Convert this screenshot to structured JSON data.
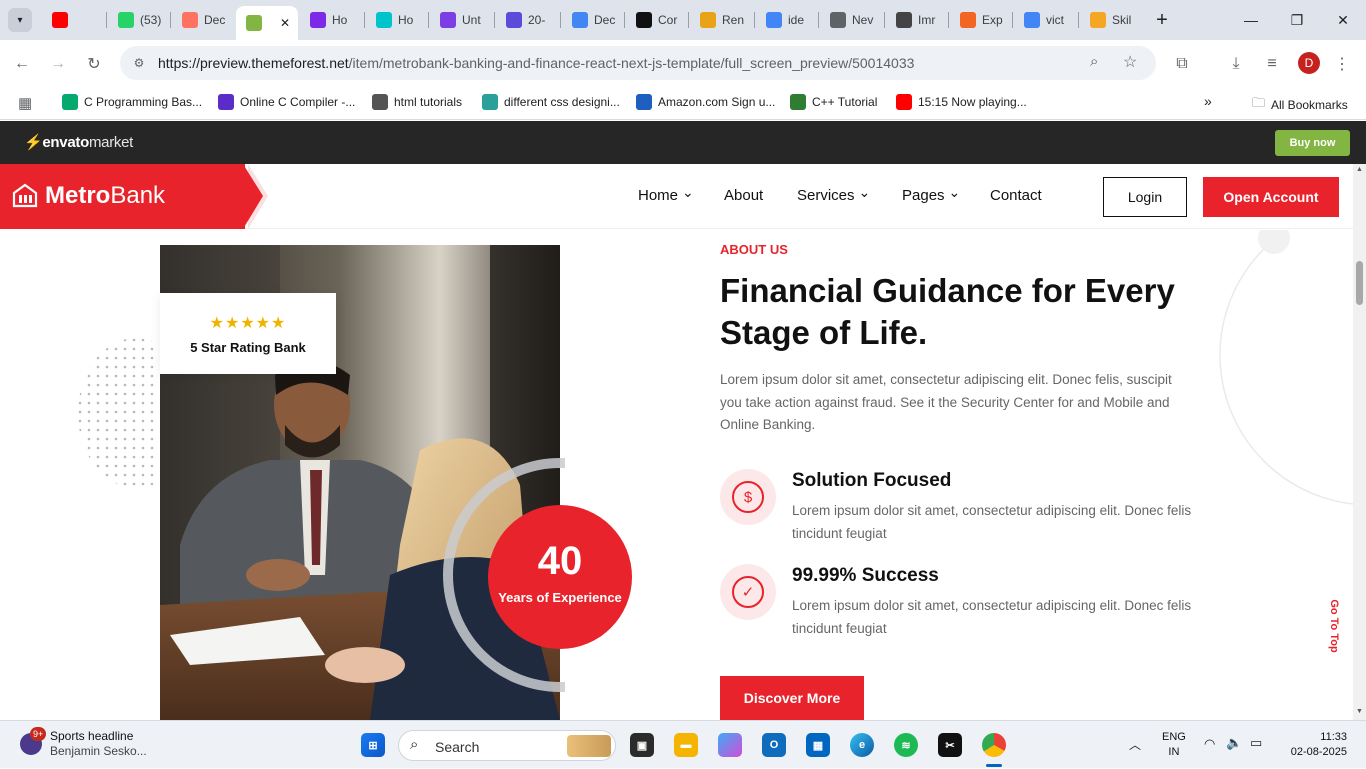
{
  "browser": {
    "tabs": [
      {
        "label": "",
        "fav": "youtube-icon",
        "color": "#ff0000"
      },
      {
        "label": "(53)",
        "fav": "whatsapp-icon",
        "color": "#25d366"
      },
      {
        "label": "Dec",
        "fav": "figma-icon",
        "color": "#ff7262"
      },
      {
        "label": "",
        "fav": "envato-icon",
        "color": "#82b541"
      },
      {
        "label": "Ho",
        "fav": "canva-icon",
        "color": "#7d2ae8"
      },
      {
        "label": "Ho",
        "fav": "canva-icon",
        "color": "#00c4cc"
      },
      {
        "label": "Unt",
        "fav": "app-icon",
        "color": "#7b3fe4"
      },
      {
        "label": "20-",
        "fav": "app-icon",
        "color": "#5b4bdb"
      },
      {
        "label": "Dec",
        "fav": "docs-icon",
        "color": "#4285f4"
      },
      {
        "label": "Cor",
        "fav": "nextjs-icon",
        "color": "#111111"
      },
      {
        "label": "Ren",
        "fav": "cap-icon",
        "color": "#e8a317"
      },
      {
        "label": "ide",
        "fav": "google-icon",
        "color": "#4285f4"
      },
      {
        "label": "Nev",
        "fav": "chrome-icon",
        "color": "#5f6368"
      },
      {
        "label": "Imr",
        "fav": "image-icon",
        "color": "#444444"
      },
      {
        "label": "Exp",
        "fav": "app-icon",
        "color": "#f26522"
      },
      {
        "label": "vict",
        "fav": "google-icon",
        "color": "#4285f4"
      },
      {
        "label": "Skil",
        "fav": "app-icon",
        "color": "#f5a623"
      }
    ],
    "url_host": "https://preview.themeforest.net",
    "url_rest": "/item/metrobank-banking-and-finance-react-next-js-template/full_screen_preview/50014033",
    "profile_initial": "D",
    "bookmarks": [
      {
        "label": "C Programming Bas...",
        "fav": "w3schools-icon",
        "color": "#04aa6d"
      },
      {
        "label": "Online C Compiler -...",
        "fav": "compiler-icon",
        "color": "#5a2dc8"
      },
      {
        "label": "html tutorials",
        "fav": "html-icon",
        "color": "#555555"
      },
      {
        "label": "different css designi...",
        "fav": "css-icon",
        "color": "#2aa198"
      },
      {
        "label": "Amazon.com Sign u...",
        "fav": "amazon-icon",
        "color": "#1e5fbf"
      },
      {
        "label": "C++ Tutorial",
        "fav": "w3resource-icon",
        "color": "#2e7d32"
      },
      {
        "label": "15:15 Now playing...",
        "fav": "youtube-icon",
        "color": "#ff0000"
      }
    ],
    "all_bookmarks": "All Bookmarks"
  },
  "envato": {
    "logo_bold": "envato",
    "logo_rest": "market",
    "buy_now": "Buy now"
  },
  "header": {
    "logo_bold": "Metro",
    "logo_rest": "Bank",
    "nav": [
      {
        "label": "Home",
        "dropdown": true
      },
      {
        "label": "About",
        "dropdown": false
      },
      {
        "label": "Services",
        "dropdown": true
      },
      {
        "label": "Pages",
        "dropdown": true
      },
      {
        "label": "Contact",
        "dropdown": false
      }
    ],
    "login": "Login",
    "open_account": "Open Account"
  },
  "about": {
    "tag": "ABOUT US",
    "title": "Financial Guidance for Every Stage of Life.",
    "description": "Lorem ipsum dolor sit amet, consectetur adipiscing elit. Donec felis, suscipit you take action against fraud. See it the Security Center for and Mobile and Online Banking.",
    "rating_stars": "★★★★★",
    "rating_label": "5 Star Rating Bank",
    "years_number": "40",
    "years_label": "Years of Experience",
    "features": [
      {
        "title": "Solution Focused",
        "desc": "Lorem ipsum dolor sit amet, consectetur adipiscing elit. Donec felis tincidunt feugiat",
        "icon": "dollar-icon"
      },
      {
        "title": "99.99% Success",
        "desc": "Lorem ipsum dolor sit amet, consectetur adipiscing elit. Donec felis tincidunt feugiat",
        "icon": "check-icon"
      }
    ],
    "discover": "Discover More",
    "go_top": "Go To Top"
  },
  "taskbar": {
    "news_title": "Sports headline",
    "news_sub": "Benjamin Sesko...",
    "news_badge": "9+",
    "search": "Search",
    "lang_1": "ENG",
    "lang_2": "IN",
    "time": "11:33",
    "date": "02-08-2025"
  },
  "colors": {
    "brand_red": "#e8232b",
    "envato_green": "#82b541",
    "dark": "#262626"
  }
}
